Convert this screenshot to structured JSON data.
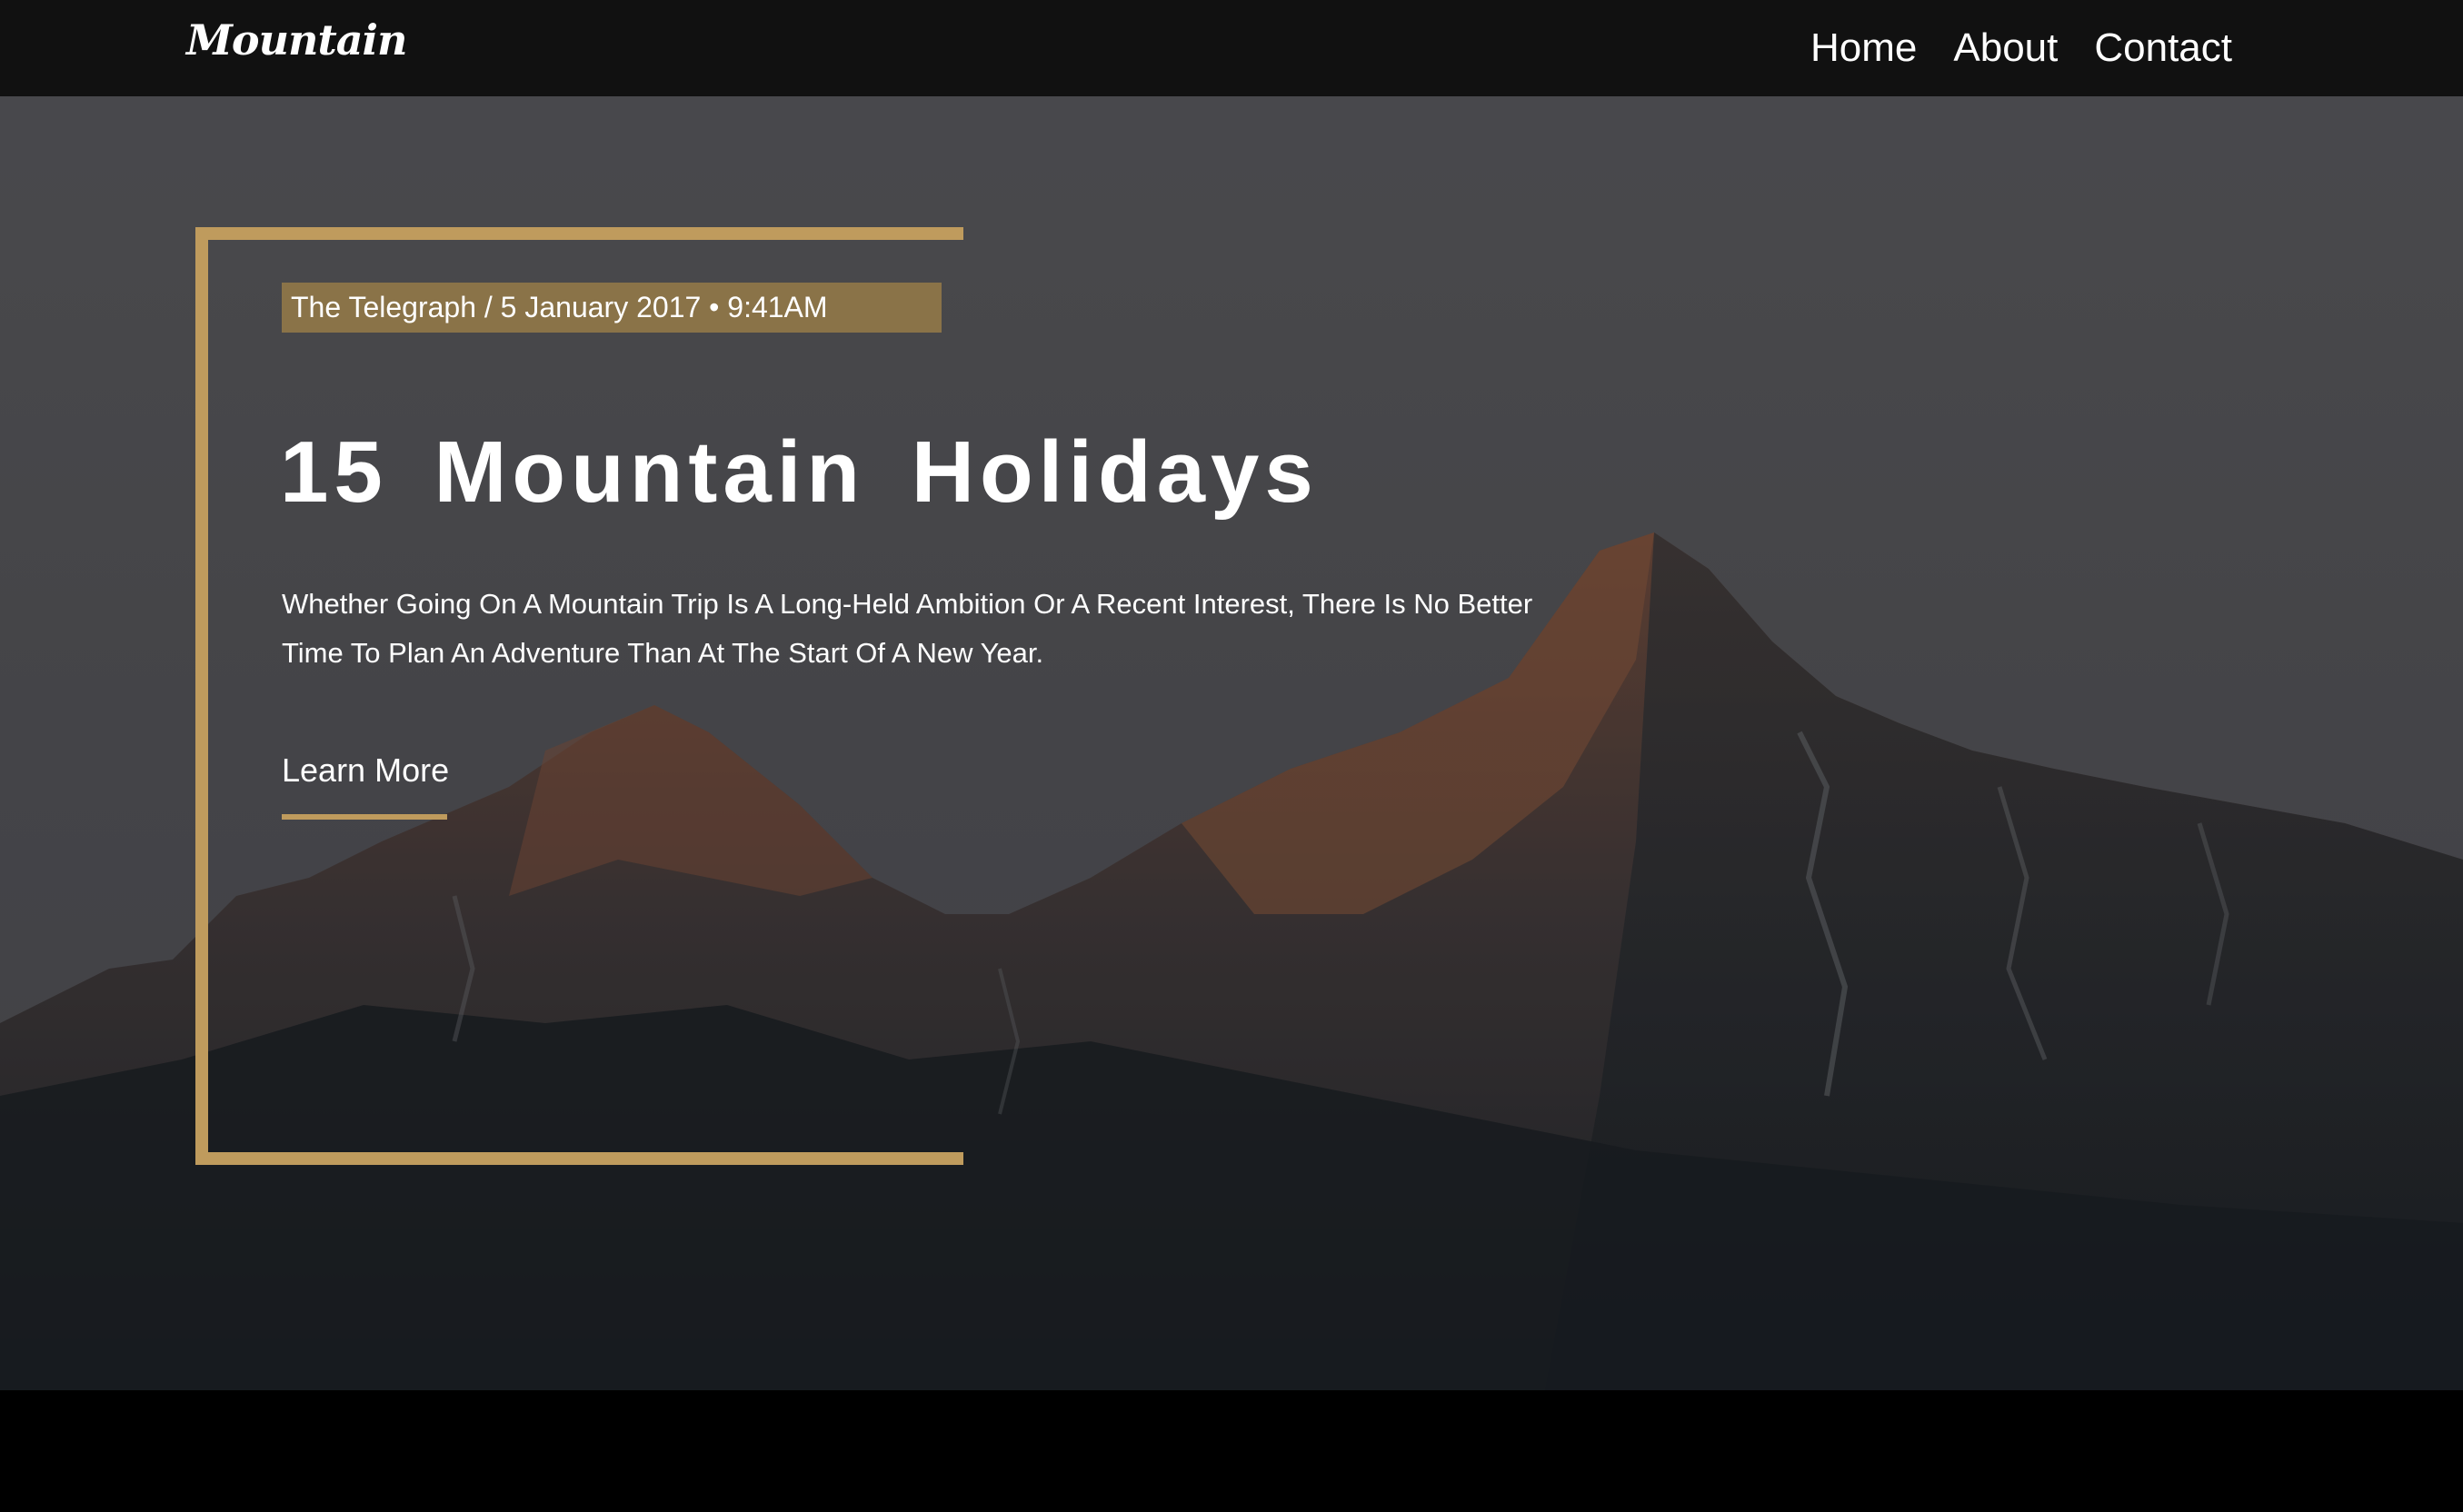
{
  "brand": {
    "logo_text": "Mountain"
  },
  "nav": {
    "items": [
      {
        "label": "Home"
      },
      {
        "label": "About"
      },
      {
        "label": "Contact"
      }
    ]
  },
  "hero": {
    "meta": "The Telegraph / 5 January 2017 • 9:41AM",
    "title": "15 Mountain Holidays",
    "description": "Whether Going On A Mountain Trip Is A Long-Held Ambition Or A Recent Interest, There Is No Better Time To Plan An Adventure Than At The Start Of A New Year.",
    "cta_label": "Learn More"
  },
  "colors": {
    "accent_gold": "#bf9b5d",
    "meta_bg": "#8a7348",
    "navbar_bg": "#111111",
    "footer_bg": "#000000"
  }
}
